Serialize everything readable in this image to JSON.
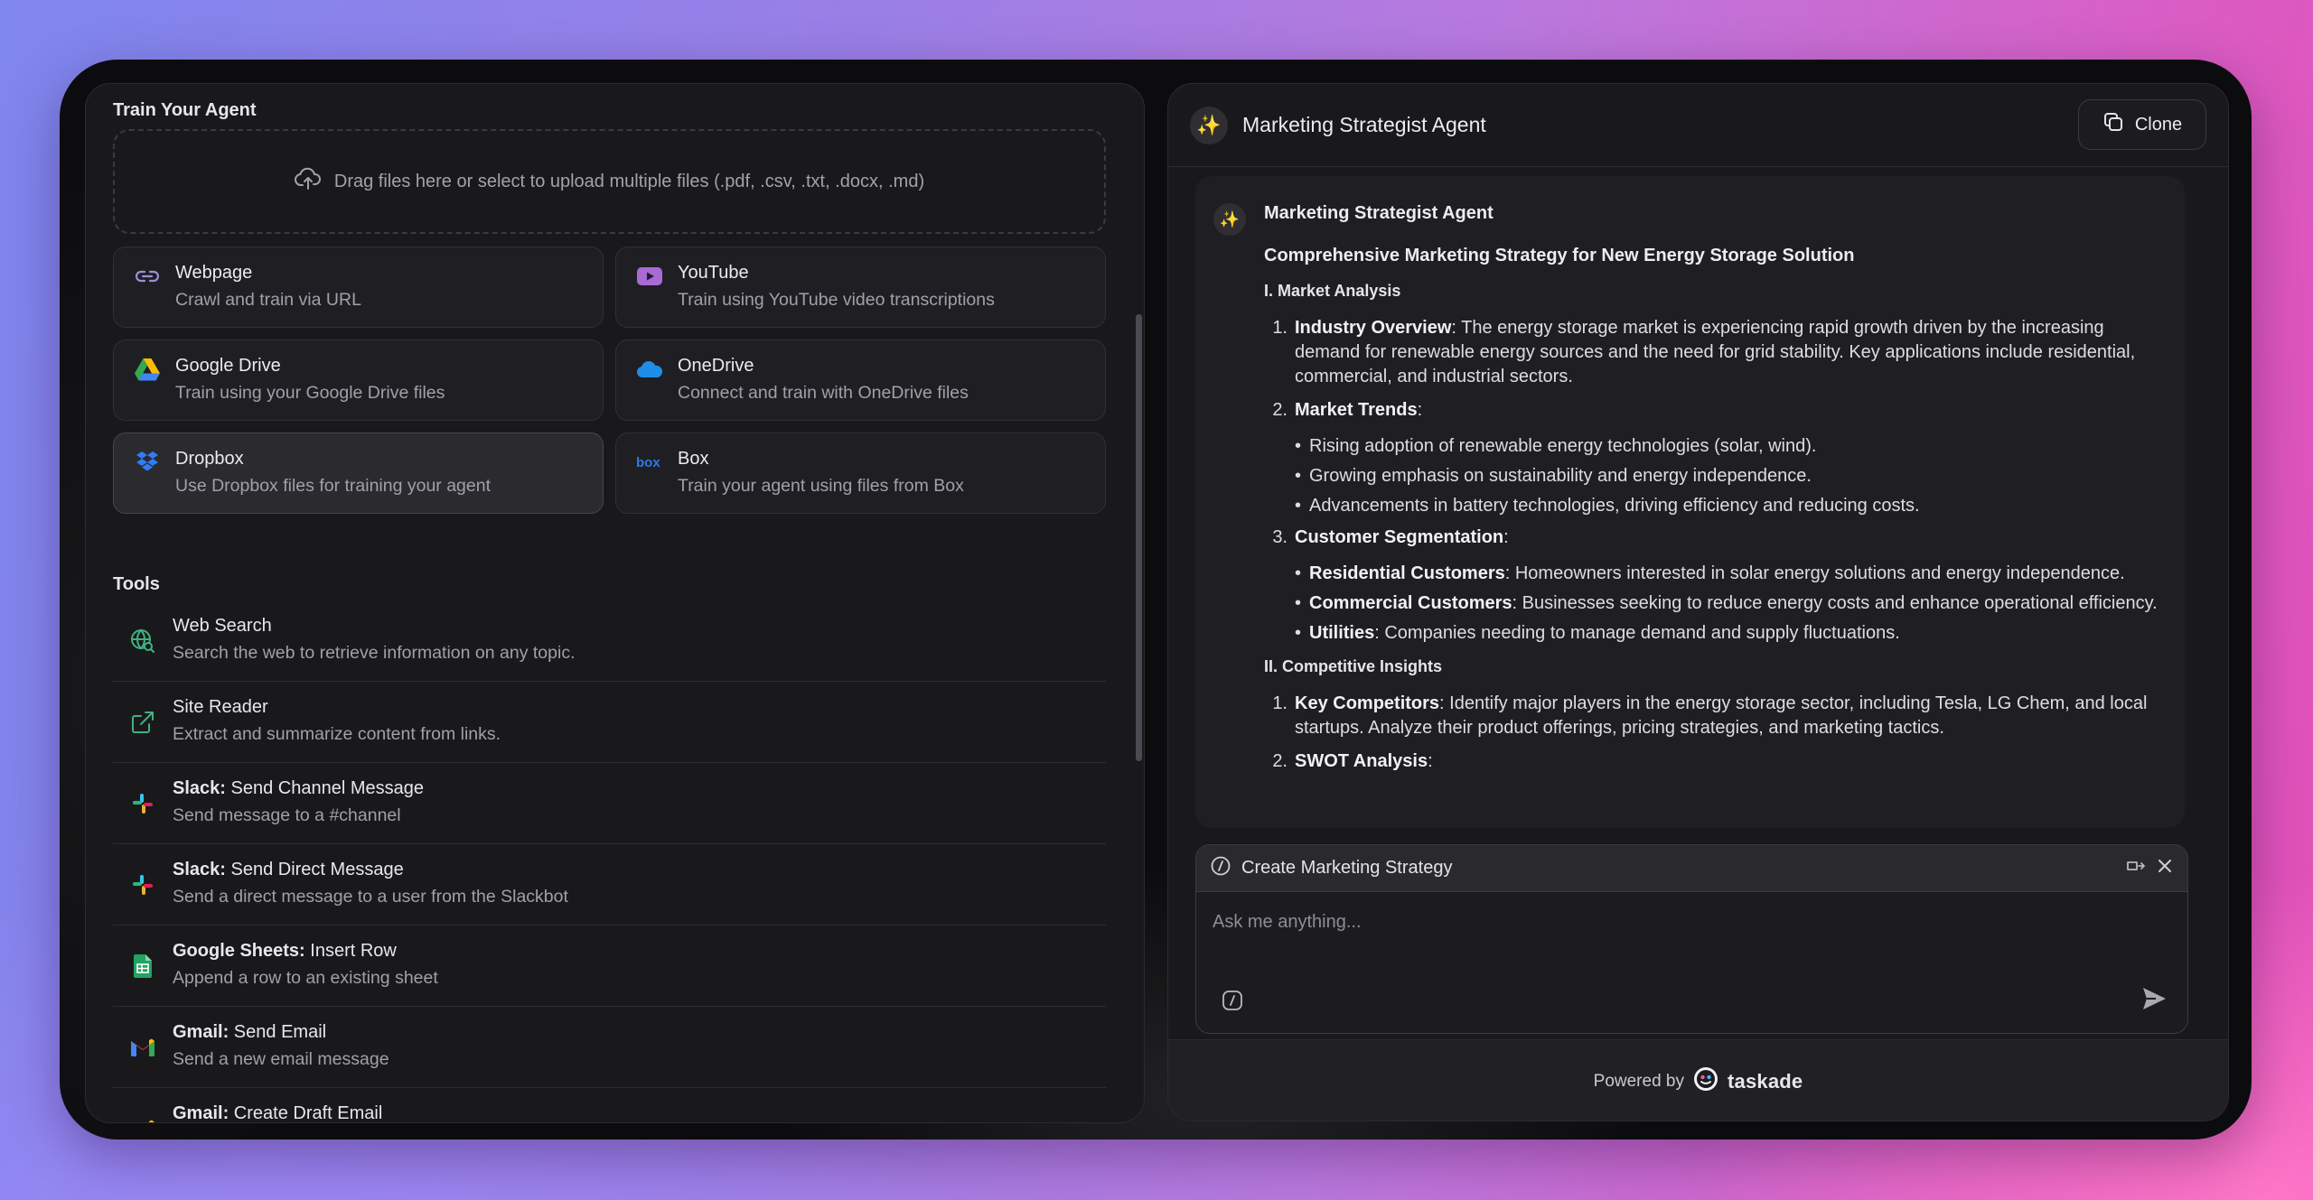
{
  "train": {
    "title": "Train Your Agent",
    "dropzone": "Drag files here or select to upload multiple files (.pdf, .csv, .txt, .docx, .md)",
    "sources": [
      {
        "title": "Webpage",
        "desc": "Crawl and train via URL",
        "icon": "link-icon"
      },
      {
        "title": "YouTube",
        "desc": "Train using YouTube video transcriptions",
        "icon": "youtube-icon"
      },
      {
        "title": "Google Drive",
        "desc": "Train using your Google Drive files",
        "icon": "google-drive-icon"
      },
      {
        "title": "OneDrive",
        "desc": "Connect and train with OneDrive files",
        "icon": "onedrive-icon"
      },
      {
        "title": "Dropbox",
        "desc": "Use Dropbox files for training your agent",
        "icon": "dropbox-icon"
      },
      {
        "title": "Box",
        "desc": "Train your agent using files from Box",
        "icon": "box-icon"
      }
    ]
  },
  "tools": {
    "title": "Tools",
    "items": [
      {
        "prefix": "",
        "title": "Web Search",
        "desc": "Search the web to retrieve information on any topic.",
        "icon": "globe-search-icon"
      },
      {
        "prefix": "",
        "title": "Site Reader",
        "desc": "Extract and summarize content from links.",
        "icon": "external-link-icon"
      },
      {
        "prefix": "Slack:",
        "title": " Send Channel Message",
        "desc": "Send message to a #channel",
        "icon": "slack-icon"
      },
      {
        "prefix": "Slack:",
        "title": " Send Direct Message",
        "desc": "Send a direct message to a user from the Slackbot",
        "icon": "slack-icon"
      },
      {
        "prefix": "Google Sheets:",
        "title": " Insert Row",
        "desc": "Append a row to an existing sheet",
        "icon": "google-sheets-icon"
      },
      {
        "prefix": "Gmail:",
        "title": " Send Email",
        "desc": "Send a new email message",
        "icon": "gmail-icon"
      },
      {
        "prefix": "Gmail:",
        "title": " Create Draft Email",
        "desc": "",
        "icon": "gmail-icon"
      }
    ]
  },
  "agent": {
    "name": "Marketing Strategist Agent",
    "clone_label": "Clone",
    "message": {
      "sender": "Marketing Strategist Agent",
      "heading": "Comprehensive Marketing Strategy for New Energy Storage Solution",
      "section1": "I. Market Analysis",
      "items": [
        {
          "num": "1.",
          "bold": "Industry Overview",
          "text": ": The energy storage market is experiencing rapid growth driven by the increasing demand for renewable energy sources and the need for grid stability. Key applications include residential, commercial, and industrial sectors."
        },
        {
          "num": "2.",
          "bold": "Market Trends",
          "text": ":"
        }
      ],
      "trends": [
        "Rising adoption of renewable energy technologies (solar, wind).",
        "Growing emphasis on sustainability and energy independence.",
        "Advancements in battery technologies, driving efficiency and reducing costs."
      ],
      "item3": {
        "num": "3.",
        "bold": "Customer Segmentation",
        "text": ":"
      },
      "segments": [
        {
          "bold": "Residential Customers",
          "text": ": Homeowners interested in solar energy solutions and energy independence."
        },
        {
          "bold": "Commercial Customers",
          "text": ": Businesses seeking to reduce energy costs and enhance operational efficiency."
        },
        {
          "bold": "Utilities",
          "text": ": Companies needing to manage demand and supply fluctuations."
        }
      ],
      "section2": "II. Competitive Insights",
      "comp_items": [
        {
          "num": "1.",
          "bold": "Key Competitors",
          "text": ": Identify major players in the energy storage sector, including Tesla, LG Chem, and local startups. Analyze their product offerings, pricing strategies, and marketing tactics."
        },
        {
          "num": "2.",
          "bold": "SWOT Analysis",
          "text": ":"
        }
      ]
    },
    "composer": {
      "task_label": "Create Marketing Strategy",
      "placeholder": "Ask me anything..."
    },
    "footer": {
      "powered_by": "Powered by",
      "brand": "taskade"
    }
  }
}
